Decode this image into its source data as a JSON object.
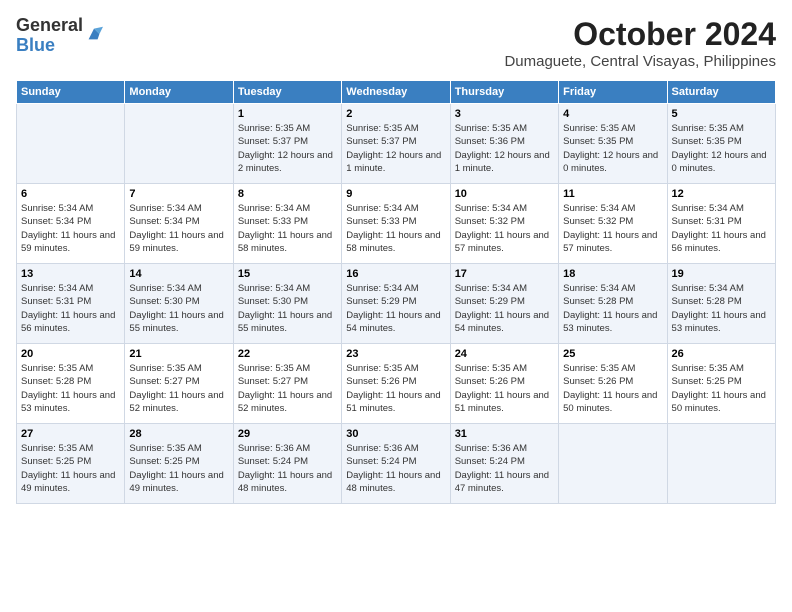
{
  "header": {
    "logo_line1": "General",
    "logo_line2": "Blue",
    "title": "October 2024",
    "subtitle": "Dumaguete, Central Visayas, Philippines"
  },
  "calendar": {
    "days_of_week": [
      "Sunday",
      "Monday",
      "Tuesday",
      "Wednesday",
      "Thursday",
      "Friday",
      "Saturday"
    ],
    "weeks": [
      [
        {
          "day": "",
          "detail": ""
        },
        {
          "day": "",
          "detail": ""
        },
        {
          "day": "1",
          "detail": "Sunrise: 5:35 AM\nSunset: 5:37 PM\nDaylight: 12 hours\nand 2 minutes."
        },
        {
          "day": "2",
          "detail": "Sunrise: 5:35 AM\nSunset: 5:37 PM\nDaylight: 12 hours\nand 1 minute."
        },
        {
          "day": "3",
          "detail": "Sunrise: 5:35 AM\nSunset: 5:36 PM\nDaylight: 12 hours\nand 1 minute."
        },
        {
          "day": "4",
          "detail": "Sunrise: 5:35 AM\nSunset: 5:35 PM\nDaylight: 12 hours\nand 0 minutes."
        },
        {
          "day": "5",
          "detail": "Sunrise: 5:35 AM\nSunset: 5:35 PM\nDaylight: 12 hours\nand 0 minutes."
        }
      ],
      [
        {
          "day": "6",
          "detail": "Sunrise: 5:34 AM\nSunset: 5:34 PM\nDaylight: 11 hours\nand 59 minutes."
        },
        {
          "day": "7",
          "detail": "Sunrise: 5:34 AM\nSunset: 5:34 PM\nDaylight: 11 hours\nand 59 minutes."
        },
        {
          "day": "8",
          "detail": "Sunrise: 5:34 AM\nSunset: 5:33 PM\nDaylight: 11 hours\nand 58 minutes."
        },
        {
          "day": "9",
          "detail": "Sunrise: 5:34 AM\nSunset: 5:33 PM\nDaylight: 11 hours\nand 58 minutes."
        },
        {
          "day": "10",
          "detail": "Sunrise: 5:34 AM\nSunset: 5:32 PM\nDaylight: 11 hours\nand 57 minutes."
        },
        {
          "day": "11",
          "detail": "Sunrise: 5:34 AM\nSunset: 5:32 PM\nDaylight: 11 hours\nand 57 minutes."
        },
        {
          "day": "12",
          "detail": "Sunrise: 5:34 AM\nSunset: 5:31 PM\nDaylight: 11 hours\nand 56 minutes."
        }
      ],
      [
        {
          "day": "13",
          "detail": "Sunrise: 5:34 AM\nSunset: 5:31 PM\nDaylight: 11 hours\nand 56 minutes."
        },
        {
          "day": "14",
          "detail": "Sunrise: 5:34 AM\nSunset: 5:30 PM\nDaylight: 11 hours\nand 55 minutes."
        },
        {
          "day": "15",
          "detail": "Sunrise: 5:34 AM\nSunset: 5:30 PM\nDaylight: 11 hours\nand 55 minutes."
        },
        {
          "day": "16",
          "detail": "Sunrise: 5:34 AM\nSunset: 5:29 PM\nDaylight: 11 hours\nand 54 minutes."
        },
        {
          "day": "17",
          "detail": "Sunrise: 5:34 AM\nSunset: 5:29 PM\nDaylight: 11 hours\nand 54 minutes."
        },
        {
          "day": "18",
          "detail": "Sunrise: 5:34 AM\nSunset: 5:28 PM\nDaylight: 11 hours\nand 53 minutes."
        },
        {
          "day": "19",
          "detail": "Sunrise: 5:34 AM\nSunset: 5:28 PM\nDaylight: 11 hours\nand 53 minutes."
        }
      ],
      [
        {
          "day": "20",
          "detail": "Sunrise: 5:35 AM\nSunset: 5:28 PM\nDaylight: 11 hours\nand 53 minutes."
        },
        {
          "day": "21",
          "detail": "Sunrise: 5:35 AM\nSunset: 5:27 PM\nDaylight: 11 hours\nand 52 minutes."
        },
        {
          "day": "22",
          "detail": "Sunrise: 5:35 AM\nSunset: 5:27 PM\nDaylight: 11 hours\nand 52 minutes."
        },
        {
          "day": "23",
          "detail": "Sunrise: 5:35 AM\nSunset: 5:26 PM\nDaylight: 11 hours\nand 51 minutes."
        },
        {
          "day": "24",
          "detail": "Sunrise: 5:35 AM\nSunset: 5:26 PM\nDaylight: 11 hours\nand 51 minutes."
        },
        {
          "day": "25",
          "detail": "Sunrise: 5:35 AM\nSunset: 5:26 PM\nDaylight: 11 hours\nand 50 minutes."
        },
        {
          "day": "26",
          "detail": "Sunrise: 5:35 AM\nSunset: 5:25 PM\nDaylight: 11 hours\nand 50 minutes."
        }
      ],
      [
        {
          "day": "27",
          "detail": "Sunrise: 5:35 AM\nSunset: 5:25 PM\nDaylight: 11 hours\nand 49 minutes."
        },
        {
          "day": "28",
          "detail": "Sunrise: 5:35 AM\nSunset: 5:25 PM\nDaylight: 11 hours\nand 49 minutes."
        },
        {
          "day": "29",
          "detail": "Sunrise: 5:36 AM\nSunset: 5:24 PM\nDaylight: 11 hours\nand 48 minutes."
        },
        {
          "day": "30",
          "detail": "Sunrise: 5:36 AM\nSunset: 5:24 PM\nDaylight: 11 hours\nand 48 minutes."
        },
        {
          "day": "31",
          "detail": "Sunrise: 5:36 AM\nSunset: 5:24 PM\nDaylight: 11 hours\nand 47 minutes."
        },
        {
          "day": "",
          "detail": ""
        },
        {
          "day": "",
          "detail": ""
        }
      ]
    ]
  }
}
